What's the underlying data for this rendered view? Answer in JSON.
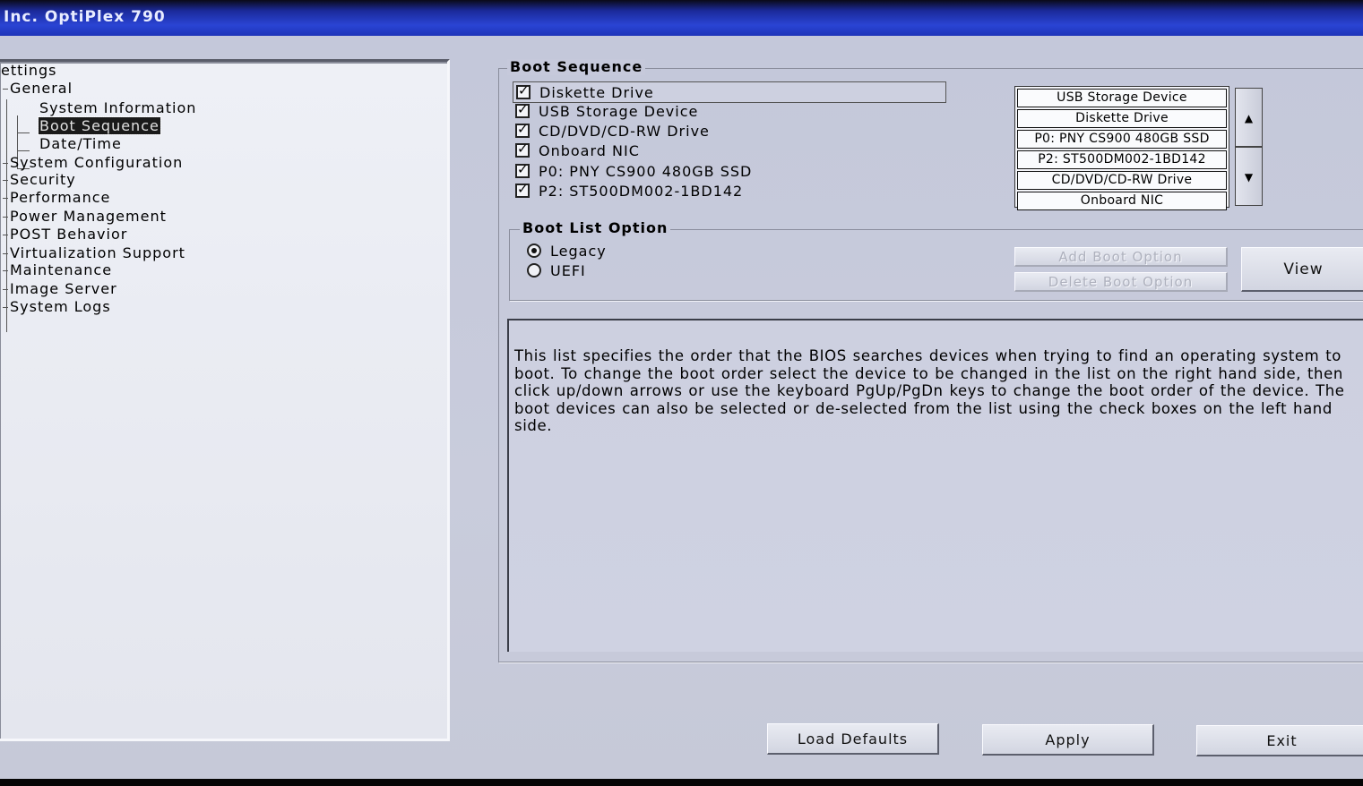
{
  "window": {
    "title": "Inc. OptiPlex 790"
  },
  "tree": {
    "root": "ettings",
    "items": [
      {
        "label": "General"
      },
      {
        "label": "System Information"
      },
      {
        "label": "Boot Sequence",
        "selected": true
      },
      {
        "label": "Date/Time"
      },
      {
        "label": "System Configuration"
      },
      {
        "label": "Security"
      },
      {
        "label": "Performance"
      },
      {
        "label": "Power Management"
      },
      {
        "label": "POST Behavior"
      },
      {
        "label": "Virtualization Support"
      },
      {
        "label": "Maintenance"
      },
      {
        "label": "Image Server"
      },
      {
        "label": "System Logs"
      }
    ]
  },
  "boot_sequence": {
    "legend": "Boot Sequence",
    "devices": [
      {
        "label": "Diskette Drive",
        "checked": true,
        "focused": true
      },
      {
        "label": "USB Storage Device",
        "checked": true
      },
      {
        "label": "CD/DVD/CD-RW Drive",
        "checked": true
      },
      {
        "label": "Onboard NIC",
        "checked": true
      },
      {
        "label": "P0: PNY CS900 480GB SSD",
        "checked": true
      },
      {
        "label": "P2: ST500DM002-1BD142",
        "checked": true
      }
    ],
    "check_mark": "✓",
    "order": [
      "USB Storage Device",
      "Diskette Drive",
      "P0: PNY CS900 480GB SSD",
      "P2: ST500DM002-1BD142",
      "CD/DVD/CD-RW Drive",
      "Onboard NIC"
    ],
    "up_arrow": "▲",
    "down_arrow": "▼"
  },
  "boot_list_option": {
    "legend": "Boot List Option",
    "options": [
      {
        "label": "Legacy",
        "selected": true
      },
      {
        "label": "UEFI",
        "selected": false
      }
    ],
    "add_button": "Add Boot Option",
    "delete_button": "Delete Boot Option",
    "view_button": "View"
  },
  "description": "This list specifies the order that the BIOS searches devices when trying to find an operating system to boot. To change the boot order select the device to be changed in the list on the right hand side, then click up/down arrows or use the keyboard PgUp/PgDn keys to change the boot order of the device. The boot devices can also be selected or de-selected from the list using the check boxes on the left hand side.",
  "footer": {
    "load_defaults": "Load Defaults",
    "apply": "Apply",
    "exit": "Exit"
  }
}
